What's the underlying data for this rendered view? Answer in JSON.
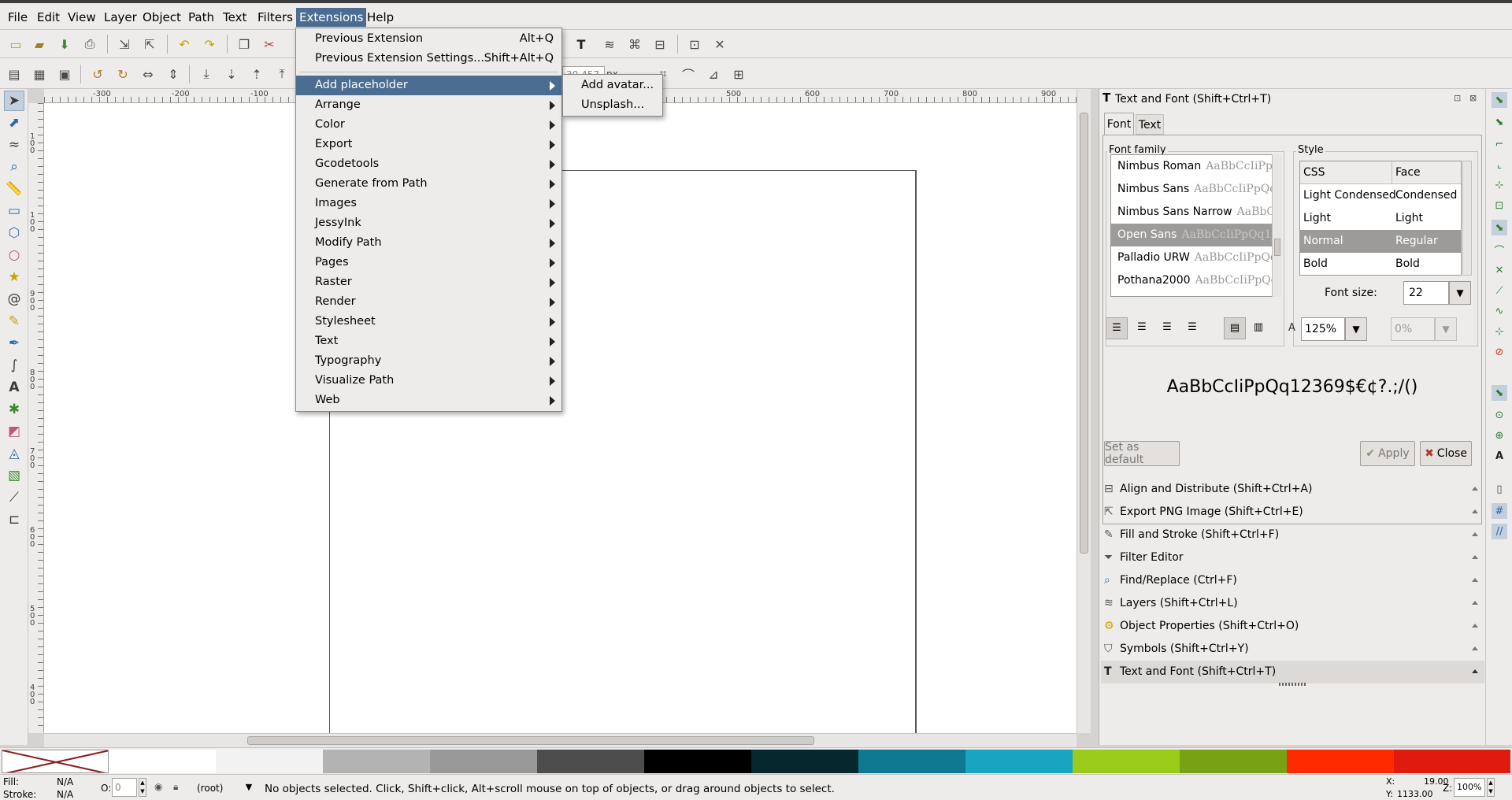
{
  "menubar": {
    "items": [
      "File",
      "Edit",
      "View",
      "Layer",
      "Object",
      "Path",
      "Text",
      "Filters",
      "Extensions",
      "Help"
    ]
  },
  "extensions_menu": {
    "previous_extension": "Previous Extension",
    "previous_extension_accel": "Alt+Q",
    "previous_settings": "Previous Extension Settings...",
    "previous_settings_accel": "Shift+Alt+Q",
    "items": [
      "Add placeholder",
      "Arrange",
      "Color",
      "Export",
      "Gcodetools",
      "Generate from Path",
      "Images",
      "JessyInk",
      "Modify Path",
      "Pages",
      "Raster",
      "Render",
      "Stylesheet",
      "Text",
      "Typography",
      "Visualize Path",
      "Web"
    ]
  },
  "placeholder_submenu": {
    "items": [
      "Add avatar...",
      "Unsplash..."
    ]
  },
  "toolbar": {
    "zoom_field_partial": "30.457",
    "unit_partial": "px"
  },
  "rulers": {
    "h_labels": [
      "-300",
      "-200",
      "-100",
      "500",
      "600",
      "700",
      "800",
      "900"
    ],
    "v_labels": [
      "1 0 0",
      "1 0 0",
      "9 0 0",
      "8 0 0",
      "7 0 0",
      "6 0 0",
      "5 0 0",
      "4 0 0"
    ]
  },
  "dialog": {
    "title": "Text and Font (Shift+Ctrl+T)",
    "tabs": [
      "Font",
      "Text"
    ],
    "font_family_label": "Font family",
    "style_label": "Style",
    "sample_text": "AaBbCcIiPpQq12",
    "fonts": [
      {
        "name": "Nimbus Roman",
        "selected": false
      },
      {
        "name": "Nimbus Sans",
        "selected": false
      },
      {
        "name": "Nimbus Sans Narrow",
        "selected": false
      },
      {
        "name": "Open Sans",
        "selected": true
      },
      {
        "name": "Palladio URW",
        "selected": false
      },
      {
        "name": "Pothana2000",
        "selected": false
      }
    ],
    "style_headers": [
      "CSS",
      "Face"
    ],
    "styles": [
      {
        "css": "Light Condensed",
        "face": "Condensed",
        "selected": false
      },
      {
        "css": "Light",
        "face": "Light",
        "selected": false
      },
      {
        "css": "Normal",
        "face": "Regular",
        "selected": true
      },
      {
        "css": "Bold",
        "face": "Bold",
        "selected": false
      }
    ],
    "font_size_label": "Font size:",
    "font_size": "22",
    "line_spacing": "125%",
    "letter_spacing": "0%",
    "preview": "AaBbCcIiPpQq12369$€¢?.;/()",
    "set_default": "Set as default",
    "apply": "Apply",
    "close": "Close"
  },
  "docked_dialogs": [
    {
      "label": "Align and Distribute (Shift+Ctrl+A)",
      "icon": "align-icon"
    },
    {
      "label": "Export PNG Image (Shift+Ctrl+E)",
      "icon": "export-icon"
    },
    {
      "label": "Fill and Stroke (Shift+Ctrl+F)",
      "icon": "fill-stroke-icon"
    },
    {
      "label": "Filter Editor",
      "icon": "filter-icon"
    },
    {
      "label": "Find/Replace (Ctrl+F)",
      "icon": "find-icon"
    },
    {
      "label": "Layers (Shift+Ctrl+L)",
      "icon": "layers-icon"
    },
    {
      "label": "Object Properties (Shift+Ctrl+O)",
      "icon": "object-props-icon"
    },
    {
      "label": "Symbols (Shift+Ctrl+Y)",
      "icon": "symbols-icon"
    },
    {
      "label": "Text and Font (Shift+Ctrl+T)",
      "icon": "text-icon"
    }
  ],
  "palette": {
    "colors": [
      "#ffffff",
      "#f2f2f2",
      "#b3b3b3",
      "#999999",
      "#4d4d4d",
      "#000000",
      "#05282e",
      "#0e7990",
      "#18a5bf",
      "#9acb1a",
      "#78a214",
      "#ff2a00",
      "#e11a10"
    ]
  },
  "status": {
    "fill_label": "Fill:",
    "fill_value": "N/A",
    "stroke_label": "Stroke:",
    "stroke_value": "N/A",
    "opacity_label": "O:",
    "opacity_value": "0",
    "layer": "(root)",
    "message": "No objects selected. Click, Shift+click, Alt+scroll mouse on top of objects, or drag around objects to select.",
    "x_label": "X:",
    "x_value": "19.00",
    "y_label": "Y:",
    "y_value": "1133.00",
    "zoom_label": "Z:",
    "zoom_value": "100%"
  }
}
